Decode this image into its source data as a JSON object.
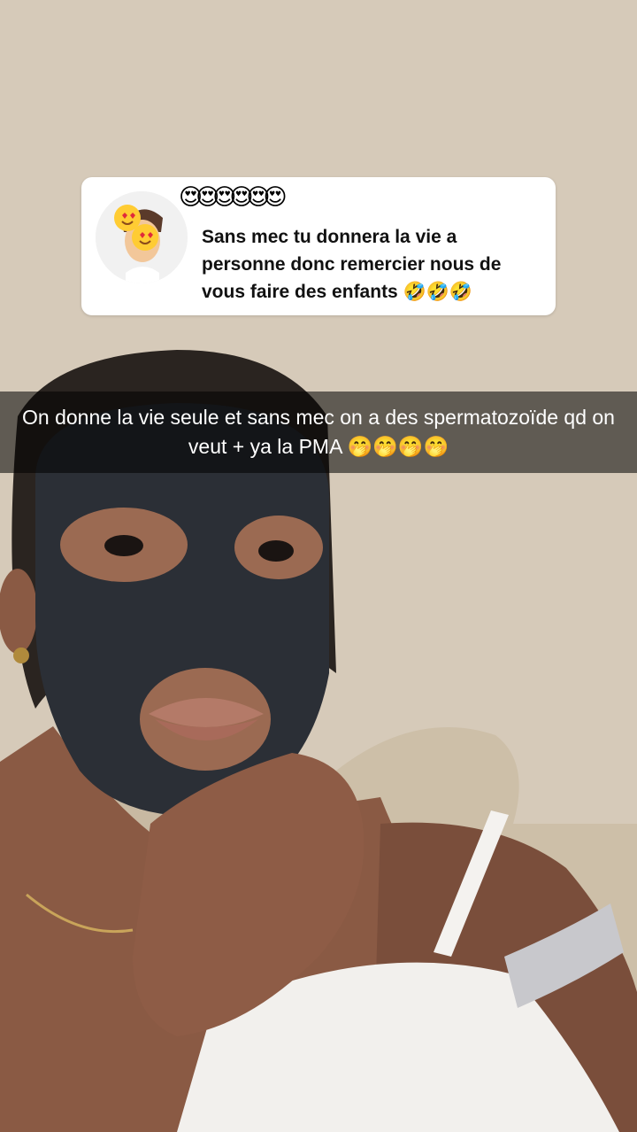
{
  "reply_card": {
    "name_emojis": "😍😍😍😍😍😍",
    "text": "Sans mec tu donnera la vie a personne donc remercier nous de vous faire des enfants 🤣🤣🤣",
    "avatar_icon": "bitmoji-heart-eyes-avatar"
  },
  "caption": {
    "text": "On donne la vie seule et sans mec on a des spermatozoïde qd on veut + ya la PMA 🤭🤭🤭🤭"
  }
}
